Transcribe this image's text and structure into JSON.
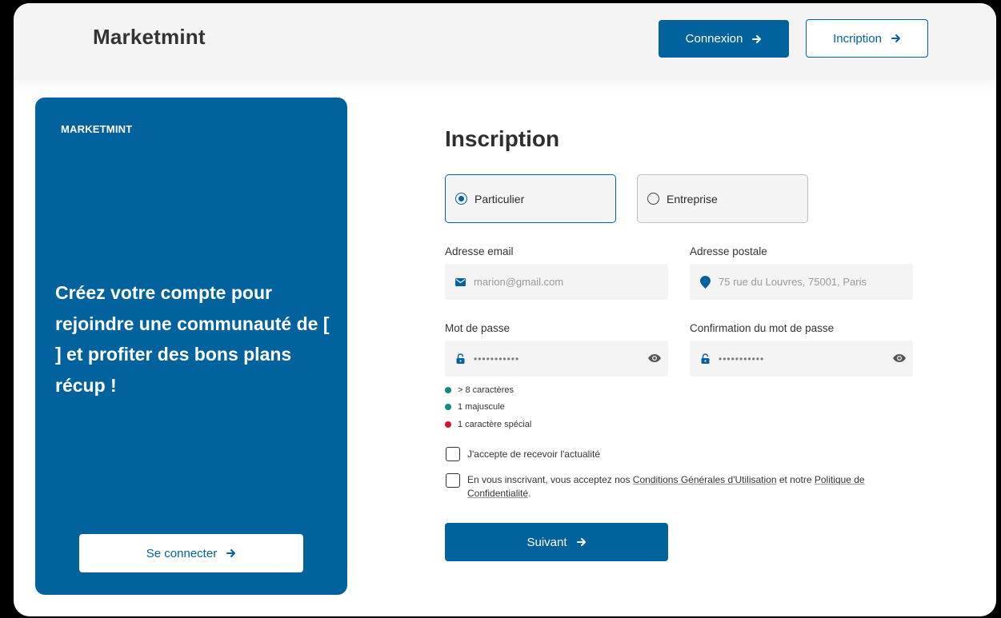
{
  "header": {
    "brand": "Marketmint",
    "login_label": "Connexion",
    "signup_label": "Incription"
  },
  "left_panel": {
    "brand": "MARKETMINT",
    "text": "Créez votre compte pour rejoindre une communauté de [        ] et profiter des bons plans récup !",
    "button_label": "Se connecter"
  },
  "form": {
    "title": "Inscription",
    "account_types": [
      {
        "label": "Particulier",
        "selected": true
      },
      {
        "label": "Entreprise",
        "selected": false
      }
    ],
    "email": {
      "label": "Adresse email",
      "placeholder": "marion@gmail.com",
      "icon": "mail-icon"
    },
    "address": {
      "label": "Adresse postale",
      "placeholder": "75 rue du Louvres, 75001, Paris",
      "icon": "location-pin-icon"
    },
    "password": {
      "label": "Mot de passe",
      "value": "•••••••••••",
      "icon": "lock-icon"
    },
    "password_confirm": {
      "label": "Confirmation du mot de passe",
      "value": "•••••••••••",
      "icon": "lock-icon"
    },
    "rules": [
      {
        "text": "> 8 caractères",
        "status": "ok"
      },
      {
        "text": "1 majuscule",
        "status": "ok"
      },
      {
        "text": "1 caractère spécial",
        "status": "error"
      }
    ],
    "newsletter_label": "J'accepte de recevoir l'actualité",
    "terms": {
      "prefix": "En vous inscrivant, vous acceptez nos ",
      "cgu_link": "Conditions Générales d'Utilisation",
      "middle": " et notre ",
      "privacy_link": "Politique de Confidentialité",
      "suffix": "."
    },
    "submit_label": "Suivant"
  },
  "colors": {
    "primary": "#01629d",
    "ok": "#0f8a86",
    "error": "#e0102c",
    "field_bg": "#f4f4f4"
  }
}
